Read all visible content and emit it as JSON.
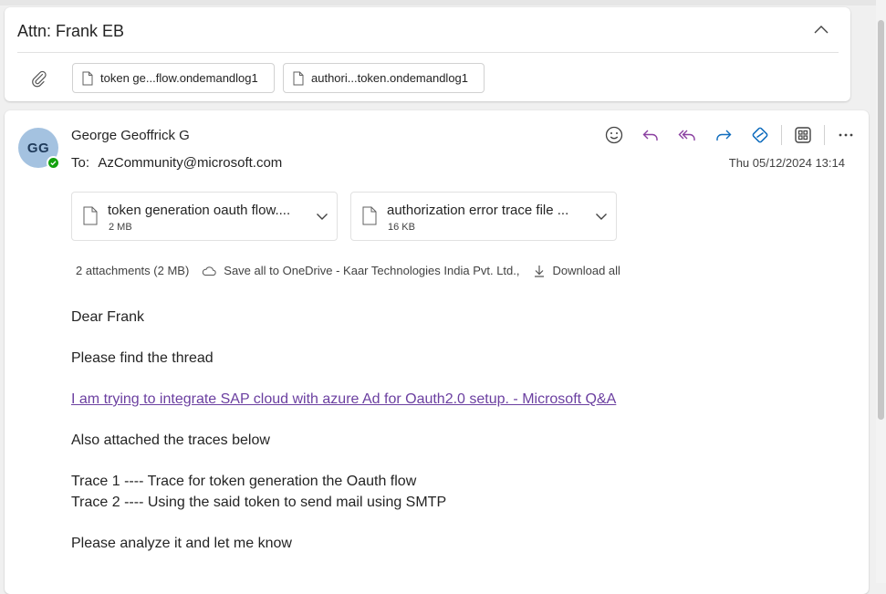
{
  "thread": {
    "subject": "Attn: Frank EB",
    "attachments": [
      {
        "name": "token ge...flow.ondemandlog1"
      },
      {
        "name": "authori...token.ondemandlog1"
      }
    ]
  },
  "message": {
    "avatar_initials": "GG",
    "sender": "George Geoffrick G",
    "to_label": "To:",
    "to_address": "AzCommunity@microsoft.com",
    "date": "Thu 05/12/2024 13:14",
    "actions": [
      "emoji-icon",
      "reply-icon",
      "reply-all-icon",
      "forward-icon",
      "loop-icon",
      "apps-icon",
      "more-icon"
    ],
    "attachments": [
      {
        "name": "token generation oauth flow....",
        "size": "2 MB"
      },
      {
        "name": "authorization error trace file ...",
        "size": "16 KB"
      }
    ],
    "attachments_summary": "2 attachments (2 MB)",
    "save_all_label": "Save all to OneDrive - Kaar Technologies India Pvt. Ltd.,",
    "download_all_label": "Download all",
    "body": {
      "greeting": "Dear Frank",
      "line1": "Please find the thread",
      "link_text": "I am trying to integrate SAP cloud with azure Ad for Oauth2.0 setup. - Microsoft Q&A",
      "line2": "Also attached the traces below",
      "trace1": "Trace 1  ---- Trace for token generation the Oauth flow",
      "trace2": "Trace 2 ---- Using the said token to send mail using SMTP",
      "closing": "Please analyze it and let me know"
    }
  },
  "colors": {
    "accent": "#0f6cbd",
    "link": "#6b3fa0",
    "presence": "#13a10e",
    "avatar_bg": "#a4c2e0",
    "reply_all": "#8a3fa0"
  }
}
